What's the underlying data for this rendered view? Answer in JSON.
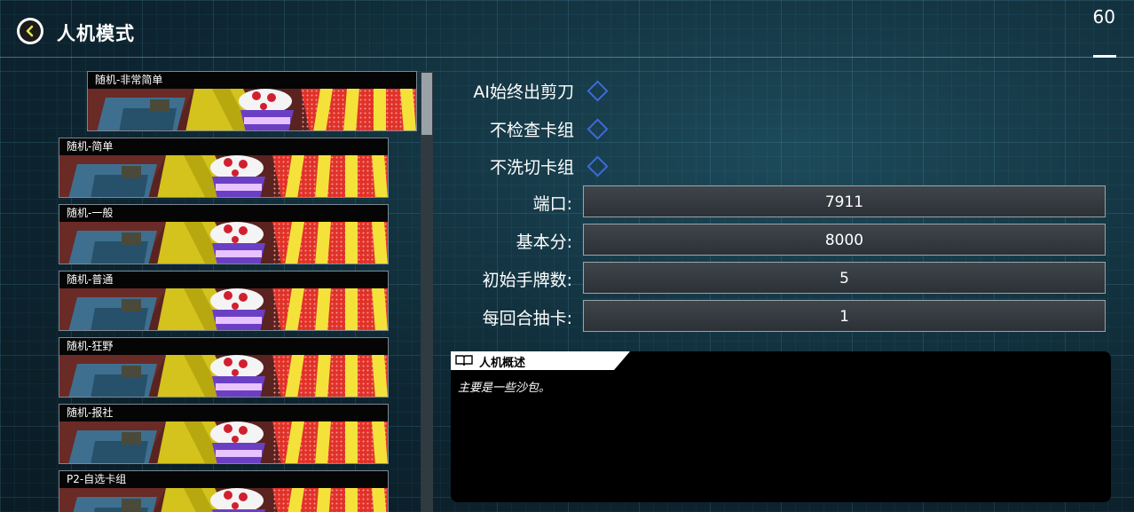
{
  "header": {
    "title": "人机模式",
    "fps": "60"
  },
  "deck_list": {
    "items": [
      {
        "label": "随机-非常简单",
        "selected": true
      },
      {
        "label": "随机-简单"
      },
      {
        "label": "随机-一般"
      },
      {
        "label": "随机-普通"
      },
      {
        "label": "随机-狂野"
      },
      {
        "label": "随机-报社"
      },
      {
        "label": "P2-自选卡组"
      }
    ]
  },
  "options": {
    "ai_scissors": "AI始终出剪刀",
    "no_deck_check": "不检查卡组",
    "no_shuffle": "不洗切卡组"
  },
  "fields": {
    "port": {
      "label": "端口:",
      "value": "7911"
    },
    "base_lp": {
      "label": "基本分:",
      "value": "8000"
    },
    "start_hand": {
      "label": "初始手牌数:",
      "value": "5"
    },
    "draw_per_turn": {
      "label": "每回合抽卡:",
      "value": "1"
    }
  },
  "description": {
    "title": "人机概述",
    "text": "主要是一些沙包。"
  },
  "colors": {
    "accent": "#3c6bd8",
    "back_arrow": "#e6e64a"
  }
}
